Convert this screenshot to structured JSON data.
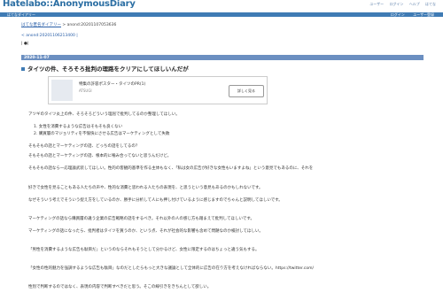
{
  "header": {
    "logo": "Hatelabo::AnonymousDiary",
    "nav": [
      "ユーザー",
      "ログイン",
      "ヘルプ",
      "はてな"
    ],
    "bar_left": "はてなダイアリー",
    "bar_right": [
      "ログイン",
      "ユーザー登録"
    ]
  },
  "breadcrumb": {
    "link": "はてな匿名ダイアリー",
    "sep": " > ",
    "current": "anond:20201107053636"
  },
  "prev_link": "< anond:20201106213400 |",
  "pager": "| ●|",
  "date": "2020-11-07",
  "entry": {
    "title": "タイツの件、そろそろ批判の理路をクリアにしてほしいんだが",
    "card_title": "特集の許容ポスター・タイツのPR(1)",
    "card_sub": "ATSUGI",
    "card_button": "詳しく見る"
  },
  "paragraphs": [
    "アツギのタイツ炎上の件、そろそろどういう理屈で批判してるのか整理してほしい。",
    "1. 女性を消費するような広告はそもそも良くない",
    "2. 購買層のマジョリティを不愉快にさせる広告はマーケティングとして失敗",
    "そもそもの話とマーケティングの話、どっちの話をしてるの？",
    "そもそもの話とマーケティングの話、根本的に噛み合ってないと思うんだけど。",
    "そもそもの話なら一応理論武装してほしい。性的の客観的基準を作る主体もなく、「私は女の広告が好きな女性もいますよね」という意見でもあるのに、それを",
    "好きで女性を見ることもある人たちの声や、性的な消費と思われる人たちの表現を、と思うという意見もあるのかもしれないです。",
    "なぜそういう考えでそういう捉え方をしているのか、勝手に分析して人にも押し付けているように感じますのでちゃんと説明してほしいです。",
    "マーケティングの話なら購買層の違う企業の広告戦略の話をするべき。それ以外の人の感じ方も踏まえて批判してほしいです。",
    "マーケティングの話になったら、批判者はタイツを買うのか、という点、それが社会的な影響も含めて問題なのか検討してほしい。",
    "「男性を消費するような広告も駄目だ」というのならそれもそうとして分かるけど、女性に限定するのはちょっと違う気もする。",
    "「女性の性的魅力を強調するような広告も駄目」なのだとしたらもっと大きな議論として全体的に広告の在り方を考えなければならない。https://twitter.com/",
    "性別で判断するのではなく、表現の内容で判断すべきだと思う。そこの線引きをきちんとして欲しい。"
  ]
}
